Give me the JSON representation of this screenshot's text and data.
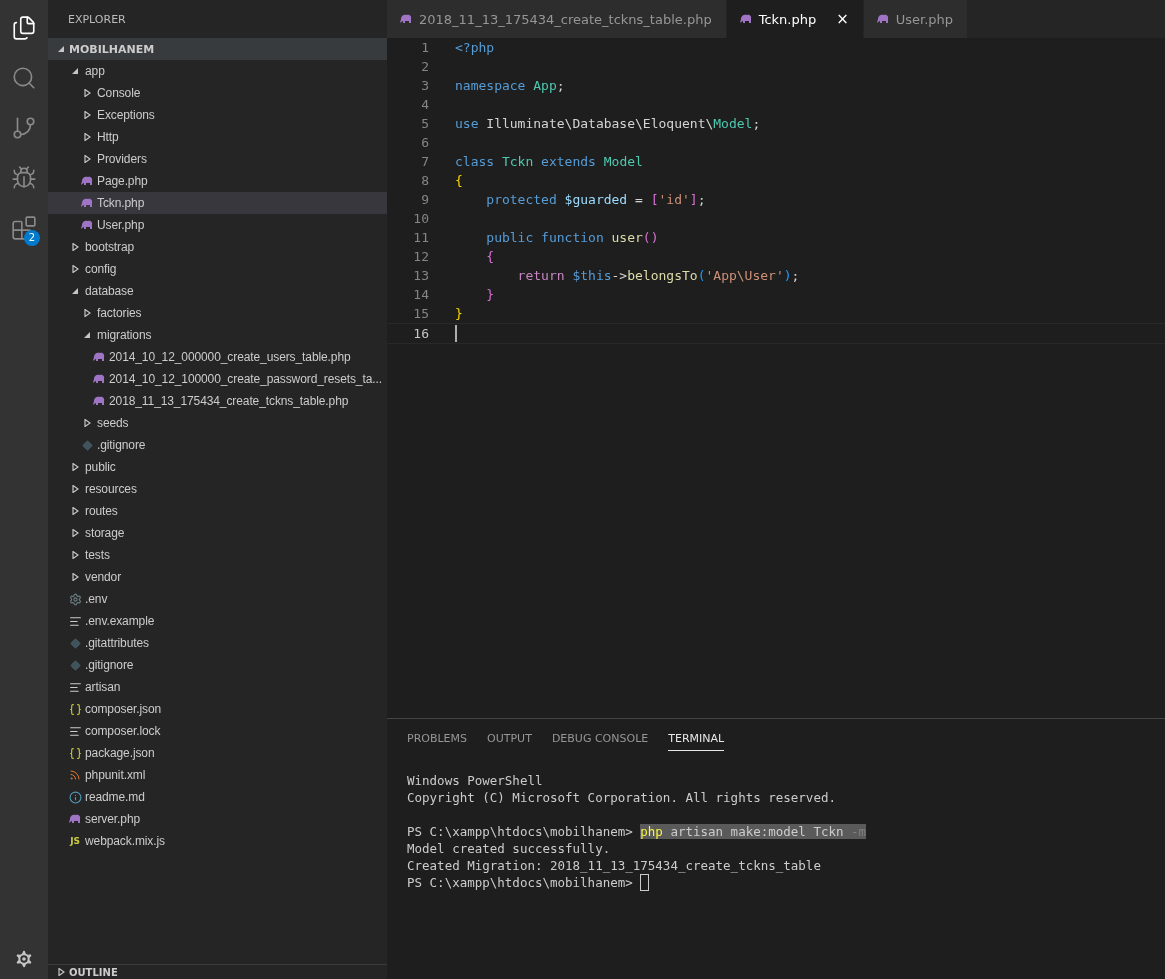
{
  "activity_bar": {
    "items": [
      {
        "kind": "files",
        "selected": true
      },
      {
        "kind": "search",
        "selected": false
      },
      {
        "kind": "git",
        "selected": false
      },
      {
        "kind": "debug",
        "selected": false
      },
      {
        "kind": "extensions",
        "selected": false,
        "badge": "2"
      }
    ],
    "settings": {
      "kind": "gear"
    }
  },
  "explorer": {
    "title": "EXPLORER",
    "root": {
      "label": "MOBILHANEM",
      "expanded": true
    },
    "tree": [
      {
        "label": "app",
        "kind": "folder",
        "expanded": true,
        "selected": false,
        "children": [
          {
            "label": "Console",
            "kind": "folder",
            "expanded": false,
            "selected": false
          },
          {
            "label": "Exceptions",
            "kind": "folder",
            "expanded": false,
            "selected": false
          },
          {
            "label": "Http",
            "kind": "folder",
            "expanded": false,
            "selected": false
          },
          {
            "label": "Providers",
            "kind": "folder",
            "expanded": false,
            "selected": false
          },
          {
            "label": "Page.php",
            "kind": "php",
            "selected": false
          },
          {
            "label": "Tckn.php",
            "kind": "php",
            "selected": true
          },
          {
            "label": "User.php",
            "kind": "php",
            "selected": false
          }
        ]
      },
      {
        "label": "bootstrap",
        "kind": "folder",
        "expanded": false,
        "selected": false
      },
      {
        "label": "config",
        "kind": "folder",
        "expanded": false,
        "selected": false
      },
      {
        "label": "database",
        "kind": "folder",
        "expanded": true,
        "selected": false,
        "children": [
          {
            "label": "factories",
            "kind": "folder",
            "expanded": false,
            "selected": false
          },
          {
            "label": "migrations",
            "kind": "folder",
            "expanded": true,
            "selected": false,
            "children": [
              {
                "label": "2014_10_12_000000_create_users_table.php",
                "kind": "php",
                "selected": false
              },
              {
                "label": "2014_10_12_100000_create_password_resets_ta...",
                "kind": "php",
                "selected": false
              },
              {
                "label": "2018_11_13_175434_create_tckns_table.php",
                "kind": "php",
                "selected": false
              }
            ]
          },
          {
            "label": "seeds",
            "kind": "folder",
            "expanded": false,
            "selected": false
          },
          {
            "label": ".gitignore",
            "kind": "git",
            "selected": false
          }
        ]
      },
      {
        "label": "public",
        "kind": "folder",
        "expanded": false,
        "selected": false
      },
      {
        "label": "resources",
        "kind": "folder",
        "expanded": false,
        "selected": false
      },
      {
        "label": "routes",
        "kind": "folder",
        "expanded": false,
        "selected": false
      },
      {
        "label": "storage",
        "kind": "folder",
        "expanded": false,
        "selected": false
      },
      {
        "label": "tests",
        "kind": "folder",
        "expanded": false,
        "selected": false
      },
      {
        "label": "vendor",
        "kind": "folder",
        "expanded": false,
        "selected": false
      },
      {
        "label": ".env",
        "kind": "gear",
        "selected": false
      },
      {
        "label": ".env.example",
        "kind": "lines",
        "selected": false
      },
      {
        "label": ".gitattributes",
        "kind": "git",
        "selected": false
      },
      {
        "label": ".gitignore",
        "kind": "git",
        "selected": false
      },
      {
        "label": "artisan",
        "kind": "lines",
        "selected": false
      },
      {
        "label": "composer.json",
        "kind": "json",
        "selected": false
      },
      {
        "label": "composer.lock",
        "kind": "lines",
        "selected": false
      },
      {
        "label": "package.json",
        "kind": "json",
        "selected": false
      },
      {
        "label": "phpunit.xml",
        "kind": "rss",
        "selected": false
      },
      {
        "label": "readme.md",
        "kind": "info",
        "selected": false
      },
      {
        "label": "server.php",
        "kind": "php",
        "selected": false
      },
      {
        "label": "webpack.mix.js",
        "kind": "js",
        "icon_text": "JS",
        "selected": false
      }
    ],
    "outline": {
      "label": "OUTLINE",
      "expanded": false
    }
  },
  "tabs": [
    {
      "label": "2018_11_13_175434_create_tckns_table.php",
      "selected": false
    },
    {
      "label": "Tckn.php",
      "selected": true,
      "close": "×"
    },
    {
      "label": "User.php",
      "selected": false
    }
  ],
  "editor": {
    "lines": [
      {
        "number": "1",
        "current": false,
        "tokens": [
          {
            "text": "<?php",
            "kind": "keyword"
          }
        ]
      },
      {
        "number": "2",
        "current": false
      },
      {
        "number": "3",
        "current": false,
        "tokens": [
          {
            "text": "namespace ",
            "kind": "keyword"
          },
          {
            "text": "App",
            "kind": "type"
          },
          {
            "text": ";",
            "kind": "plain"
          }
        ]
      },
      {
        "number": "4",
        "current": false
      },
      {
        "number": "5",
        "current": false,
        "tokens": [
          {
            "text": "use ",
            "kind": "keyword"
          },
          {
            "text": "Illuminate\\Database\\Eloquent\\",
            "kind": "plain"
          },
          {
            "text": "Model",
            "kind": "type"
          },
          {
            "text": ";",
            "kind": "plain"
          }
        ]
      },
      {
        "number": "6",
        "current": false
      },
      {
        "number": "7",
        "current": false,
        "tokens": [
          {
            "text": "class ",
            "kind": "keyword"
          },
          {
            "text": "Tckn ",
            "kind": "type"
          },
          {
            "text": "extends ",
            "kind": "keyword"
          },
          {
            "text": "Model",
            "kind": "type"
          }
        ]
      },
      {
        "number": "8",
        "current": false,
        "tokens": [
          {
            "text": "{",
            "kind": "bracket1"
          }
        ]
      },
      {
        "number": "9",
        "current": false,
        "tokens": [
          {
            "text": "    protected ",
            "kind": "keyword"
          },
          {
            "text": "$guarded",
            "kind": "variable"
          },
          {
            "text": " = ",
            "kind": "plain"
          },
          {
            "text": "[",
            "kind": "bracket2"
          },
          {
            "text": "'id'",
            "kind": "string"
          },
          {
            "text": "]",
            "kind": "bracket2"
          },
          {
            "text": ";",
            "kind": "plain"
          }
        ]
      },
      {
        "number": "10",
        "current": false
      },
      {
        "number": "11",
        "current": false,
        "tokens": [
          {
            "text": "    public function ",
            "kind": "keyword"
          },
          {
            "text": "user",
            "kind": "function"
          },
          {
            "text": "()",
            "kind": "bracket2"
          }
        ]
      },
      {
        "number": "12",
        "current": false,
        "tokens": [
          {
            "text": "    {",
            "kind": "bracket2"
          }
        ]
      },
      {
        "number": "13",
        "current": false,
        "tokens": [
          {
            "text": "        return ",
            "kind": "control"
          },
          {
            "text": "$this",
            "kind": "keyword"
          },
          {
            "text": "->",
            "kind": "plain"
          },
          {
            "text": "belongsTo",
            "kind": "function"
          },
          {
            "text": "(",
            "kind": "bracket3"
          },
          {
            "text": "'App\\User'",
            "kind": "string"
          },
          {
            "text": ")",
            "kind": "bracket3"
          },
          {
            "text": ";",
            "kind": "plain"
          }
        ]
      },
      {
        "number": "14",
        "current": false,
        "tokens": [
          {
            "text": "    }",
            "kind": "bracket2"
          }
        ]
      },
      {
        "number": "15",
        "current": false,
        "tokens": [
          {
            "text": "}",
            "kind": "bracket1"
          }
        ]
      },
      {
        "number": "16",
        "current": true
      }
    ]
  },
  "panel": {
    "tabs": [
      {
        "label": "PROBLEMS",
        "selected": false
      },
      {
        "label": "OUTPUT",
        "selected": false
      },
      {
        "label": "DEBUG CONSOLE",
        "selected": false
      },
      {
        "label": "TERMINAL",
        "selected": true
      }
    ],
    "terminal": [
      {
        "lines": [
          {
            "tokens": [
              {
                "text": "Windows PowerShell",
                "kind": "plain"
              }
            ]
          },
          {
            "tokens": [
              {
                "text": "Copyright (C) Microsoft Corporation. All rights reserved.",
                "kind": "plain"
              }
            ]
          }
        ]
      },
      {
        "lines": [
          {
            "tokens": [
              {
                "text": "PS C:\\xampp\\htdocs\\mobilhanem> ",
                "kind": "plain"
              },
              {
                "text": "php",
                "kind": "command"
              },
              {
                "text": " artisan make:model Tckn ",
                "kind": "selected"
              },
              {
                "text": "-m",
                "kind": "flag"
              }
            ]
          },
          {
            "tokens": [
              {
                "text": "Model created successfully.",
                "kind": "plain"
              }
            ]
          },
          {
            "tokens": [
              {
                "text": "Created Migration: 2018_11_13_175434_create_tckns_table",
                "kind": "plain"
              }
            ]
          },
          {
            "tokens": [
              {
                "text": "PS C:\\xampp\\htdocs\\mobilhanem> ",
                "kind": "plain"
              }
            ],
            "cursor": true
          }
        ]
      }
    ]
  }
}
